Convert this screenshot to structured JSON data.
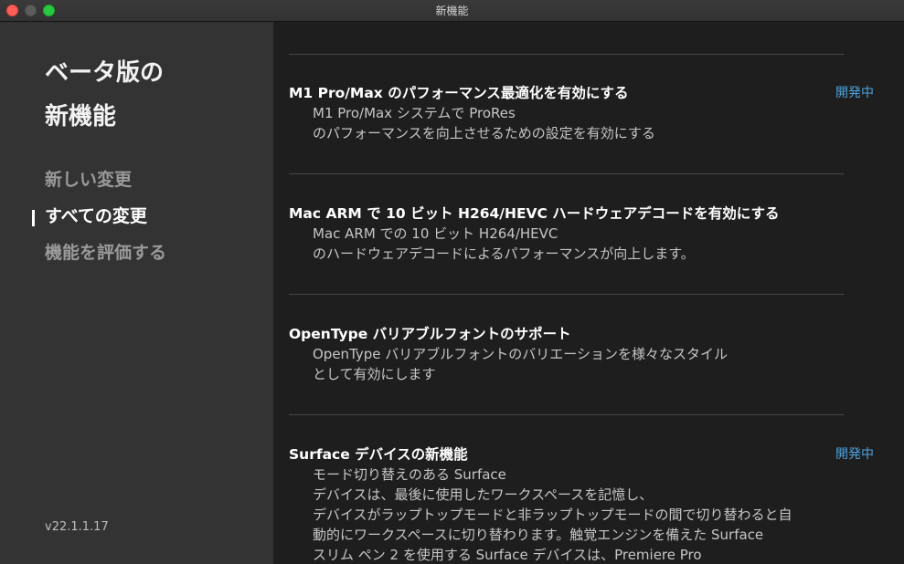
{
  "window": {
    "title": "新機能"
  },
  "sidebar": {
    "heading_line1": "ベータ版の",
    "heading_line2": "新機能",
    "items": [
      {
        "label": "新しい変更",
        "active": false
      },
      {
        "label": "すべての変更",
        "active": true
      },
      {
        "label": "機能を評価する",
        "active": false
      }
    ],
    "version": "v22.1.1.17"
  },
  "features": [
    {
      "title": "M1 Pro/Max のパフォーマンス最適化を有効にする",
      "badge": "開発中",
      "description": [
        "M1 Pro/Max システムで ProRes",
        "のパフォーマンスを向上させるための設定を有効にする"
      ]
    },
    {
      "title": "Mac ARM で 10 ビット H264/HEVC ハードウェアデコードを有効にする",
      "badge": "",
      "description": [
        "Mac ARM での 10 ビット H264/HEVC",
        "のハードウェアデコードによるパフォーマンスが向上します。"
      ]
    },
    {
      "title": "OpenType バリアブルフォントのサポート",
      "badge": "",
      "description": [
        "OpenType バリアブルフォントのバリエーションを様々なスタイル",
        "として有効にします"
      ]
    },
    {
      "title": "Surface デバイスの新機能",
      "badge": "開発中",
      "description": [
        "モード切り替えのある Surface",
        "デバイスは、最後に使用したワークスペースを記憶し、",
        "デバイスがラップトップモードと非ラップトップモードの間で切り替わると自",
        "動的にワークスペースに切り替わります。触覚エンジンを備えた Surface",
        "スリム ペン 2 を使用する Surface デバイスは、Premiere Pro"
      ]
    }
  ],
  "colors": {
    "sidebar_bg": "#333333",
    "main_bg": "#1e1e1e",
    "badge": "#4fa3e0"
  }
}
